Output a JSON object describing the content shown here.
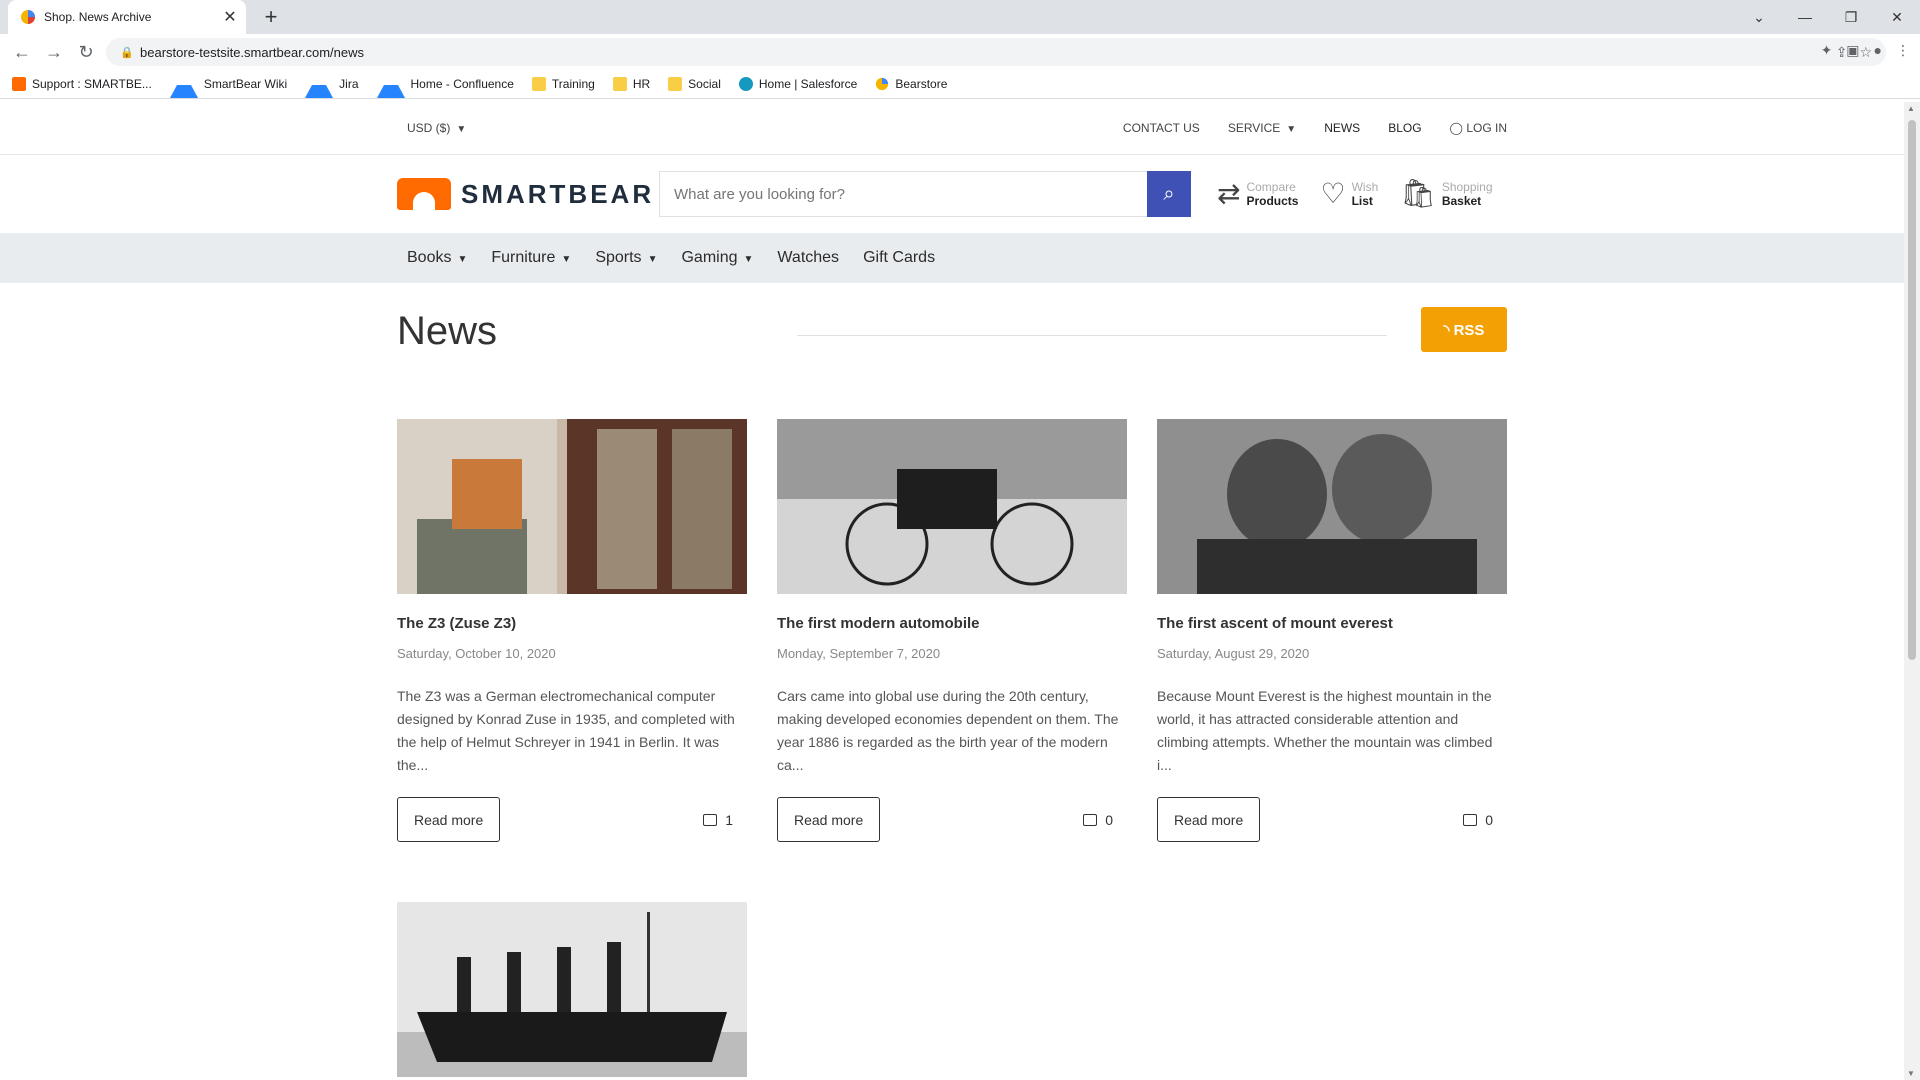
{
  "browser": {
    "tab_title": "Shop. News Archive",
    "url": "bearstore-testsite.smartbear.com/news",
    "bookmarks": [
      {
        "label": "Support : SMARTBE...",
        "icon": "smartbear-icon"
      },
      {
        "label": "SmartBear Wiki",
        "icon": "atlassian-icon"
      },
      {
        "label": "Jira",
        "icon": "atlassian-icon"
      },
      {
        "label": "Home - Confluence",
        "icon": "atlassian-icon"
      },
      {
        "label": "Training",
        "icon": "folder-icon"
      },
      {
        "label": "HR",
        "icon": "folder-icon"
      },
      {
        "label": "Social",
        "icon": "folder-icon"
      },
      {
        "label": "Home | Salesforce",
        "icon": "salesforce-icon"
      },
      {
        "label": "Bearstore",
        "icon": "bearstore-icon"
      }
    ]
  },
  "header": {
    "currency": "USD  ($)",
    "contact": "CONTACT US",
    "service": "SERVICE",
    "news": "NEWS",
    "blog": "BLOG",
    "login": "LOG IN",
    "logo_text": "SMARTBEAR",
    "search_placeholder": "What are you looking for?",
    "compare_l1": "Compare",
    "compare_l2": "Products",
    "wish_l1": "Wish",
    "wish_l2": "List",
    "basket_l1": "Shopping",
    "basket_l2": "Basket"
  },
  "categories": [
    {
      "label": "Books",
      "dropdown": true
    },
    {
      "label": "Furniture",
      "dropdown": true
    },
    {
      "label": "Sports",
      "dropdown": true
    },
    {
      "label": "Gaming",
      "dropdown": true
    },
    {
      "label": "Watches",
      "dropdown": false
    },
    {
      "label": "Gift Cards",
      "dropdown": false
    }
  ],
  "news": {
    "title": "News",
    "rss": "RSS",
    "items": [
      {
        "title": "The Z3 (Zuse Z3)",
        "date": "Saturday, October 10, 2020",
        "desc": "The Z3 was a German electromechanical computer designed by Konrad Zuse in 1935, and completed with the help of Helmut Schreyer in 1941 in Berlin. It was the...",
        "read_more": "Read more",
        "comments": "1"
      },
      {
        "title": "The first modern automobile",
        "date": "Monday, September 7, 2020",
        "desc": "Cars came into global use during the 20th century, making developed economies dependent on them. The year 1886 is regarded as the birth year of the modern ca...",
        "read_more": "Read more",
        "comments": "0"
      },
      {
        "title": "The first ascent of mount everest",
        "date": "Saturday, August 29, 2020",
        "desc": "Because Mount Everest is the highest mountain in the world, it has attracted considerable attention and climbing attempts. Whether the mountain was climbed i...",
        "read_more": "Read more",
        "comments": "0"
      }
    ]
  },
  "colors": {
    "brand": "#ff6b00",
    "search_button": "#3f51b5",
    "rss": "#f3a005",
    "category_bar": "#e9ecef"
  }
}
